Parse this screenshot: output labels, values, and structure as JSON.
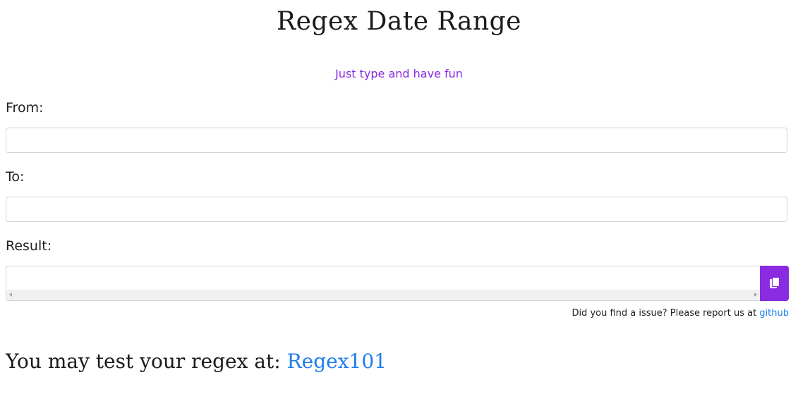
{
  "header": {
    "title": "Regex Date Range",
    "subtitle": "Just type and have fun"
  },
  "form": {
    "from_label": "From:",
    "from_value": "",
    "to_label": "To:",
    "to_value": "",
    "result_label": "Result:",
    "result_value": "",
    "copy_icon": "copy-icon"
  },
  "report": {
    "text": "Did you find a issue? Please report us at ",
    "link_text": "github"
  },
  "footer": {
    "text": "You may test your regex at: ",
    "link_text": "Regex101"
  },
  "colors": {
    "accent": "#8a2be2",
    "link": "#1e7ef0"
  }
}
